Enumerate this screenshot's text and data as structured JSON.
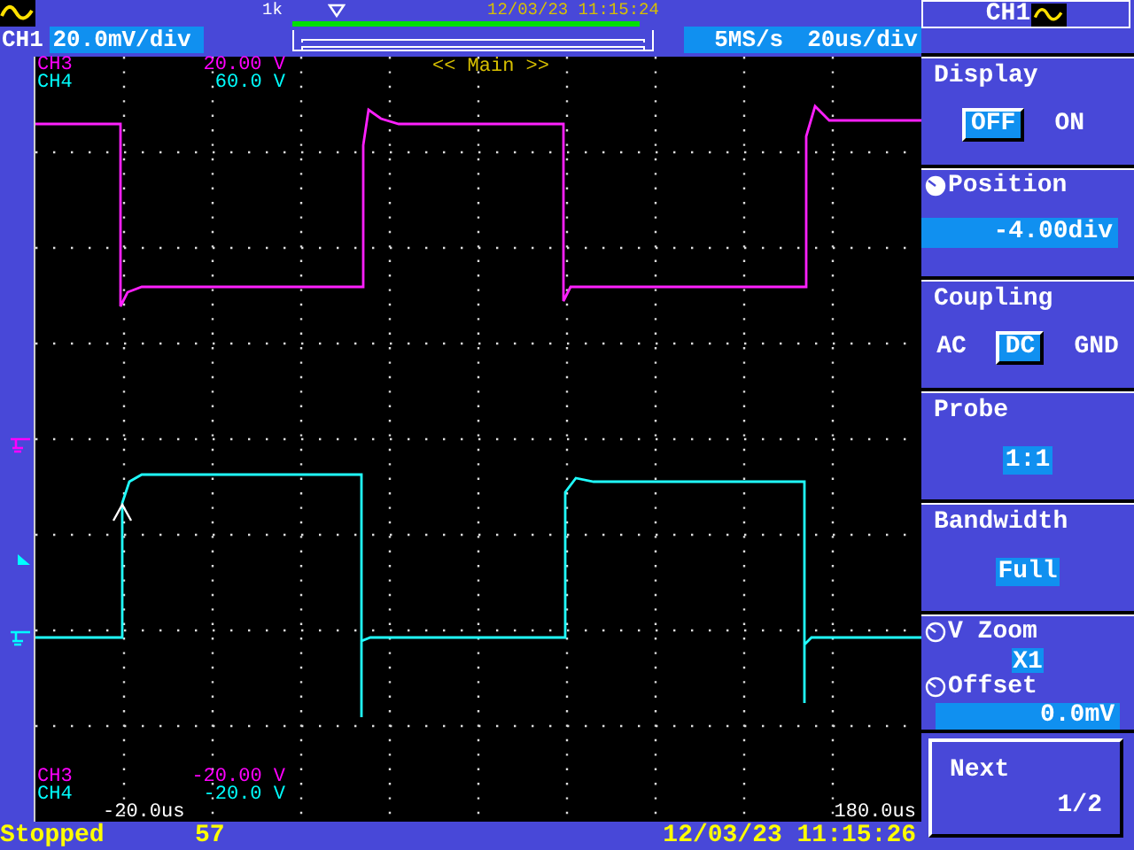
{
  "top_bar": {
    "memory_label": "1k",
    "datetime": "12/03/23 11:15:24",
    "channel": "CH1",
    "scale": "20.0mV/div",
    "sample_rate": "5MS/s",
    "timebase": "20us/div"
  },
  "screen": {
    "mode": "<< Main >>",
    "top_readouts": [
      {
        "channel": "CH3",
        "value": "20.00 V",
        "color": "#ff00ff"
      },
      {
        "channel": "CH4",
        "value": "60.0 V",
        "color": "#00ffff"
      }
    ],
    "bottom_readouts": [
      {
        "channel": "CH3",
        "value": "-20.00 V",
        "color": "#ff00ff"
      },
      {
        "channel": "CH4",
        "value": "-20.0 V",
        "color": "#00ffff"
      }
    ],
    "time_start": "-20.0us",
    "time_end": "180.0us"
  },
  "menu": {
    "title": "CH1",
    "items": [
      {
        "kind": "options",
        "label": "Display",
        "options": [
          {
            "label": "OFF",
            "selected": true
          },
          {
            "label": "ON",
            "selected": false
          }
        ]
      },
      {
        "kind": "knob",
        "label": "Position",
        "knob_active": true,
        "value": "-4.00div"
      },
      {
        "kind": "options",
        "label": "Coupling",
        "options": [
          {
            "label": "AC",
            "selected": false
          },
          {
            "label": "DC",
            "selected": true
          },
          {
            "label": "GND",
            "selected": false
          }
        ]
      },
      {
        "kind": "choice",
        "label": "Probe",
        "value": "1:1"
      },
      {
        "kind": "choice",
        "label": "Bandwidth",
        "value": "Full"
      },
      {
        "kind": "dual",
        "rows": [
          {
            "label": "V Zoom",
            "knob_active": false,
            "value": "X1"
          },
          {
            "label": "Offset",
            "knob_active": false,
            "value": "0.0mV",
            "kind": "field"
          }
        ]
      },
      {
        "kind": "button",
        "label": "Next",
        "page": "1/2"
      }
    ]
  },
  "status_bar": {
    "state": "Stopped",
    "count": "57",
    "datetime": "12/03/23 11:15:26"
  }
}
